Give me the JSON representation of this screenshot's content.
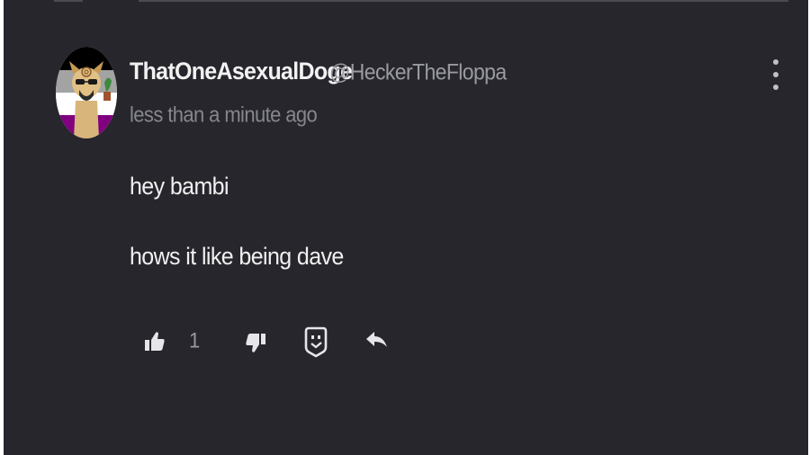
{
  "comment": {
    "username": "ThatOneAsexualDoge",
    "handle": "@HeckerTheFloppa",
    "timestamp": "less than a minute ago",
    "lines": [
      "hey bambi",
      "hows it like being dave"
    ],
    "likes": "1",
    "avatar_icon": "doge-avatar-asexual-flag"
  },
  "icons": {
    "more": "kebab-icon",
    "like": "thumbs-up-icon",
    "dislike": "thumbs-down-icon",
    "react": "face-icon",
    "reply": "reply-icon"
  },
  "colors": {
    "background": "#26262c",
    "username": "#f2f2f2",
    "muted": "#9a9aa2",
    "text": "#f0f0f0",
    "flag_black": "#000000",
    "flag_grey": "#a3a3a3",
    "flag_white": "#ffffff",
    "flag_purple": "#800080"
  }
}
